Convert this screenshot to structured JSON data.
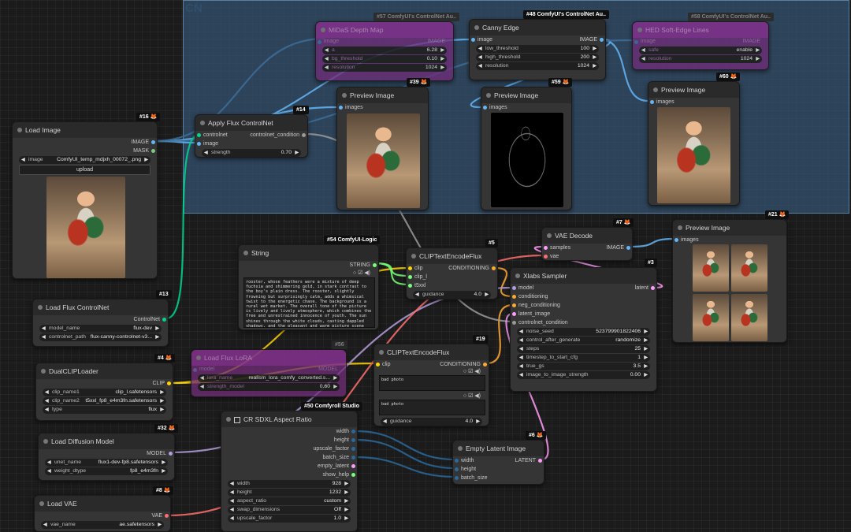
{
  "group": {
    "title": "CN"
  },
  "nodes": {
    "load_image": {
      "badge": "#16 🦊",
      "title": "Load Image",
      "out1": "IMAGE",
      "out2": "MASK",
      "w_image_label": "image",
      "w_image_value": "ComfyUI_temp_mdjxh_00072_.png",
      "upload": "upload"
    },
    "apply_cn": {
      "badge": "#14",
      "title": "Apply Flux ControlNet",
      "in1": "controlnet",
      "in2": "image",
      "out1": "controlnet_condition",
      "w_strength_label": "strength",
      "w_strength_value": "0.70"
    },
    "midas": {
      "badge": "#57 ComfyUI's ControlNet Au..",
      "title": "MiDaS Depth Map",
      "in1": "image",
      "out1": "IMAGE",
      "w1_label": "a",
      "w1_value": "6.28",
      "w2_label": "bg_threshold",
      "w2_value": "0.10",
      "w3_label": "resolution",
      "w3_value": "1024"
    },
    "canny": {
      "badge": "#48 ComfyUI's ControlNet Au..",
      "title": "Canny Edge",
      "in1": "image",
      "out1": "IMAGE",
      "w1_label": "low_threshold",
      "w1_value": "100",
      "w2_label": "high_threshold",
      "w2_value": "200",
      "w3_label": "resolution",
      "w3_value": "1024"
    },
    "hed": {
      "badge": "#58 ComfyUI's ControlNet Au..",
      "title": "HED Soft-Edge Lines",
      "in1": "image",
      "out1": "IMAGE",
      "w1_label": "safe",
      "w1_value": "enable",
      "w2_label": "resolution",
      "w2_value": "1024"
    },
    "preview39": {
      "badge": "#39 🦊",
      "title": "Preview Image",
      "in1": "images"
    },
    "preview59": {
      "badge": "#59 🦊",
      "title": "Preview Image",
      "in1": "images"
    },
    "preview60": {
      "badge": "#60 🦊",
      "title": "Preview Image",
      "in1": "images"
    },
    "string": {
      "badge": "#54 ComfyUI-Logic",
      "title": "String",
      "out1": "STRING",
      "text": "rooster, whose feathers were a mixture of deep fuchsia and shimmering gold, in stark contrast to the boy's plain dress. The rooster, slightly frowning but surprisingly calm, adds a whimsical twist to the energetic chase. The background is a rural wet market. The overall tone of the picture is lively and lively atmosphere, which combines the free and unrestrained innocence of youth. The sun shines through the white clouds, casting dappled shadows, and the pleasant and warm picture scene enhances the sense of movement and the joyous chase of the moment."
    },
    "clip5": {
      "badge": "#5",
      "title": "CLIPTextEncodeFlux",
      "in1": "clip",
      "in2": "clip_l",
      "in3": "t5xxl",
      "out1": "CONDITIONING",
      "w_guidance_label": "guidance",
      "w_guidance_value": "4.0"
    },
    "vae_decode": {
      "badge": "#7 🦊",
      "title": "VAE Decode",
      "in1": "samples",
      "in2": "vae",
      "out1": "IMAGE"
    },
    "preview21": {
      "badge": "#21 🦊",
      "title": "Preview Image",
      "in1": "images"
    },
    "xlabs": {
      "badge": "#3",
      "title": "Xlabs Sampler",
      "in1": "model",
      "in2": "conditioning",
      "in3": "neg_conditioning",
      "in4": "latent_image",
      "in5": "controlnet_condition",
      "out1": "latent",
      "w1_label": "noise_seed",
      "w1_value": "523799901822406",
      "w2_label": "control_after_generate",
      "w2_value": "randomize",
      "w3_label": "steps",
      "w3_value": "25",
      "w4_label": "timestep_to_start_cfg",
      "w4_value": "1",
      "w5_label": "true_gs",
      "w5_value": "3.5",
      "w6_label": "image_to_image_strength",
      "w6_value": "0.00"
    },
    "load_cn": {
      "badge": "#13",
      "title": "Load Flux ControlNet",
      "out1": "ControlNet",
      "w1_label": "model_name",
      "w1_value": "flux-dev",
      "w2_label": "controlnet_path",
      "w2_value": "flux-canny-controlnet-v3..."
    },
    "dualclip": {
      "badge": "#4 🦊",
      "title": "DualCLIPLoader",
      "out1": "CLIP",
      "w1_label": "clip_name1",
      "w1_value": "clip_l.safetensors",
      "w2_label": "clip_name2",
      "w2_value": "t5xxl_fp8_e4m3fn.safetensors",
      "w3_label": "type",
      "w3_value": "flux"
    },
    "load_lora": {
      "badge": "#56",
      "title": "Load Flux LoRA",
      "in1": "model",
      "out1": "MODEL",
      "w1_label": "lora_name",
      "w1_value": "realism_lora_comfy_converted.s...",
      "w2_label": "strength_model",
      "w2_value": "0.60"
    },
    "clip19": {
      "badge": "#19",
      "title": "CLIPTextEncodeFlux",
      "in1": "clip",
      "out1": "CONDITIONING",
      "text1": "bad photo",
      "text2": "bad photo",
      "w_guidance_label": "guidance",
      "w_guidance_value": "4.0"
    },
    "load_diffusion": {
      "badge": "#32 🦊",
      "title": "Load Diffusion Model",
      "out1": "MODEL",
      "w1_label": "unet_name",
      "w1_value": "flux1-dev-fp8.safetensors",
      "w2_label": "weight_dtype",
      "w2_value": "fp8_e4m3fn"
    },
    "aspect": {
      "badge": "#50 Comfyroll Studio",
      "title": "CR SDXL Aspect Ratio",
      "out1": "width",
      "out2": "height",
      "out3": "upscale_factor",
      "out4": "batch_size",
      "out5": "empty_latent",
      "out6": "show_help",
      "w1_label": "width",
      "w1_value": "928",
      "w2_label": "height",
      "w2_value": "1232",
      "w3_label": "aspect_ratio",
      "w3_value": "custom",
      "w4_label": "swap_dimensions",
      "w4_value": "Off",
      "w5_label": "upscale_factor",
      "w5_value": "1.0"
    },
    "empty_latent": {
      "badge": "#6 🦊",
      "title": "Empty Latent Image",
      "in1": "width",
      "in2": "height",
      "in3": "batch_size",
      "out1": "LATENT"
    },
    "load_vae": {
      "badge": "#8 🦊",
      "title": "Load VAE",
      "out1": "VAE",
      "w1_label": "vae_name",
      "w1_value": "ae.safetensors"
    }
  },
  "colors": {
    "image": "#64b5f6",
    "mask": "#81c784",
    "clip": "#ffd500",
    "conditioning": "#ffa931",
    "model": "#b39ddb",
    "vae": "#ff6e6e",
    "latent": "#ff9cf9",
    "controlnet": "#00d78d",
    "int": "#29699c",
    "string": "#77ff77"
  }
}
